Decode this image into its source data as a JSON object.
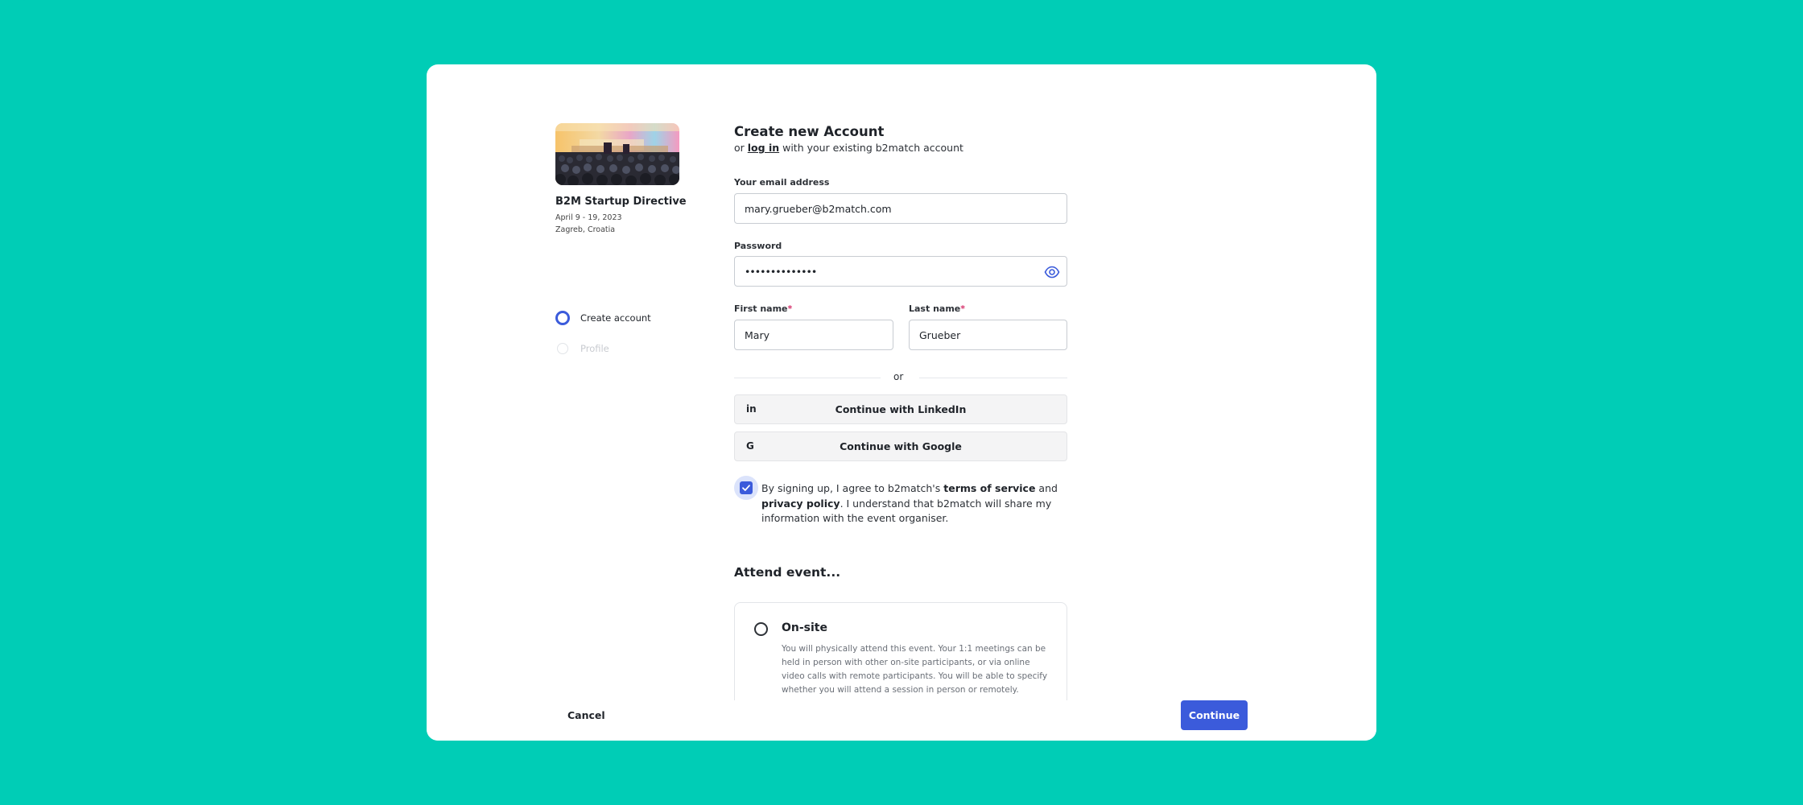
{
  "event": {
    "title": "B2M Startup Directive",
    "date": "April 9 - 19, 2023",
    "location": "Zagreb, Croatia"
  },
  "steps": [
    {
      "label": "Create account",
      "state": "active"
    },
    {
      "label": "Profile",
      "state": "inactive"
    }
  ],
  "form": {
    "title": "Create new Account",
    "login_prefix": "or ",
    "login_link": "log in",
    "login_suffix": " with your existing b2match account",
    "email_label": "Your email address",
    "email_value": "mary.grueber@b2match.com",
    "password_label": "Password",
    "password_value": "••••••••••••••",
    "first_name_label": "First name",
    "first_name_value": "Mary",
    "last_name_label": "Last name",
    "last_name_value": "Grueber",
    "required_mark": "*",
    "divider": "or",
    "linkedin_label": "Continue with LinkedIn",
    "google_label": "Continue with Google",
    "consent": {
      "checked": true,
      "part1": "By signing up, I agree to b2match's ",
      "tos": "terms of service",
      "part2": " and ",
      "privacy": "privacy policy",
      "part3": ". I understand that b2match will share my information with the event organiser."
    }
  },
  "attend": {
    "title": "Attend event...",
    "options": [
      {
        "title": "On-site",
        "description": "You will physically attend this event. Your 1:1 meetings can be held in person with other on-site participants, or via online video calls with remote participants. You will be able to specify whether you will attend a session in person or remotely."
      }
    ]
  },
  "footer": {
    "cancel": "Cancel",
    "continue": "Continue"
  },
  "colors": {
    "background": "#00cdb6",
    "accent": "#3b5bdb"
  },
  "icons": {
    "password_toggle": "eye-icon",
    "linkedin": "linkedin-icon",
    "google": "google-icon",
    "consent_checkbox": "check-icon"
  }
}
